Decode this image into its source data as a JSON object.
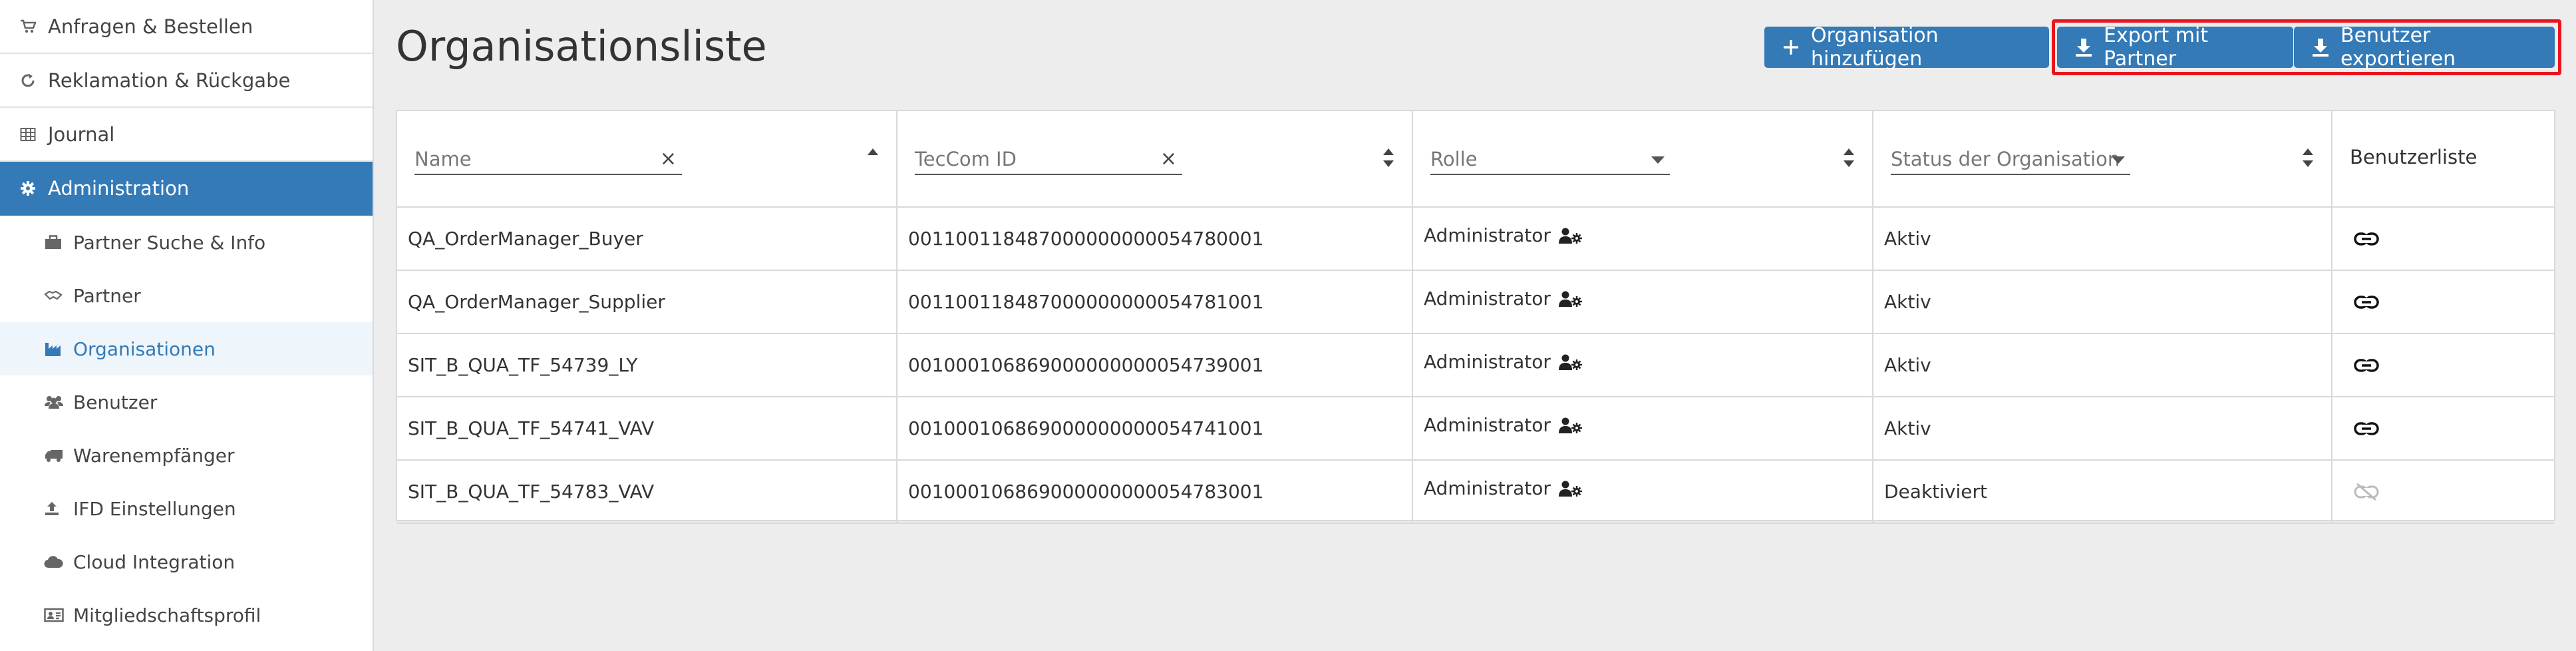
{
  "sidebar": {
    "items": [
      {
        "label": "Anfragen & Bestellen",
        "icon": "cart-icon"
      },
      {
        "label": "Reklamation & Rückgabe",
        "icon": "refresh-icon"
      },
      {
        "label": "Journal",
        "icon": "table-icon"
      },
      {
        "label": "Administration",
        "icon": "gear-icon"
      }
    ],
    "subitems": [
      {
        "label": "Partner Suche & Info",
        "icon": "briefcase-icon"
      },
      {
        "label": "Partner",
        "icon": "handshake-icon"
      },
      {
        "label": "Organisationen",
        "icon": "industry-icon"
      },
      {
        "label": "Benutzer",
        "icon": "users-icon"
      },
      {
        "label": "Warenempfänger",
        "icon": "truck-icon"
      },
      {
        "label": "IFD Einstellungen",
        "icon": "upload-icon"
      },
      {
        "label": "Cloud Integration",
        "icon": "cloud-icon"
      },
      {
        "label": "Mitgliedschaftsprofil",
        "icon": "id-card-icon"
      }
    ]
  },
  "page": {
    "title": "Organisationsliste"
  },
  "toolbar": {
    "add_label": "Organisation hinzufügen",
    "export_partner_label": "Export mit Partner",
    "export_users_label": "Benutzer exportieren"
  },
  "table": {
    "headers": {
      "name": "Name",
      "teccom_id": "TecCom ID",
      "role": "Rolle",
      "status": "Status der Organisation",
      "userlist": "Benutzerliste"
    },
    "rows": [
      {
        "name": "QA_OrderManager_Buyer",
        "id": "001100118487000000000054780001",
        "role": "Administrator",
        "status": "Aktiv",
        "link": "link-icon"
      },
      {
        "name": "QA_OrderManager_Supplier",
        "id": "001100118487000000000054781001",
        "role": "Administrator",
        "status": "Aktiv",
        "link": "link-icon"
      },
      {
        "name": "SIT_B_QUA_TF_54739_LY",
        "id": "001000106869000000000054739001",
        "role": "Administrator",
        "status": "Aktiv",
        "link": "link-icon"
      },
      {
        "name": "SIT_B_QUA_TF_54741_VAV",
        "id": "001000106869000000000054741001",
        "role": "Administrator",
        "status": "Aktiv",
        "link": "link-icon"
      },
      {
        "name": "SIT_B_QUA_TF_54783_VAV",
        "id": "001000106869000000000054783001",
        "role": "Administrator",
        "status": "Deaktiviert",
        "link": "unlink-icon"
      }
    ]
  },
  "colors": {
    "primary": "#337ab7",
    "highlight": "#e8141e",
    "background": "#ededed"
  }
}
